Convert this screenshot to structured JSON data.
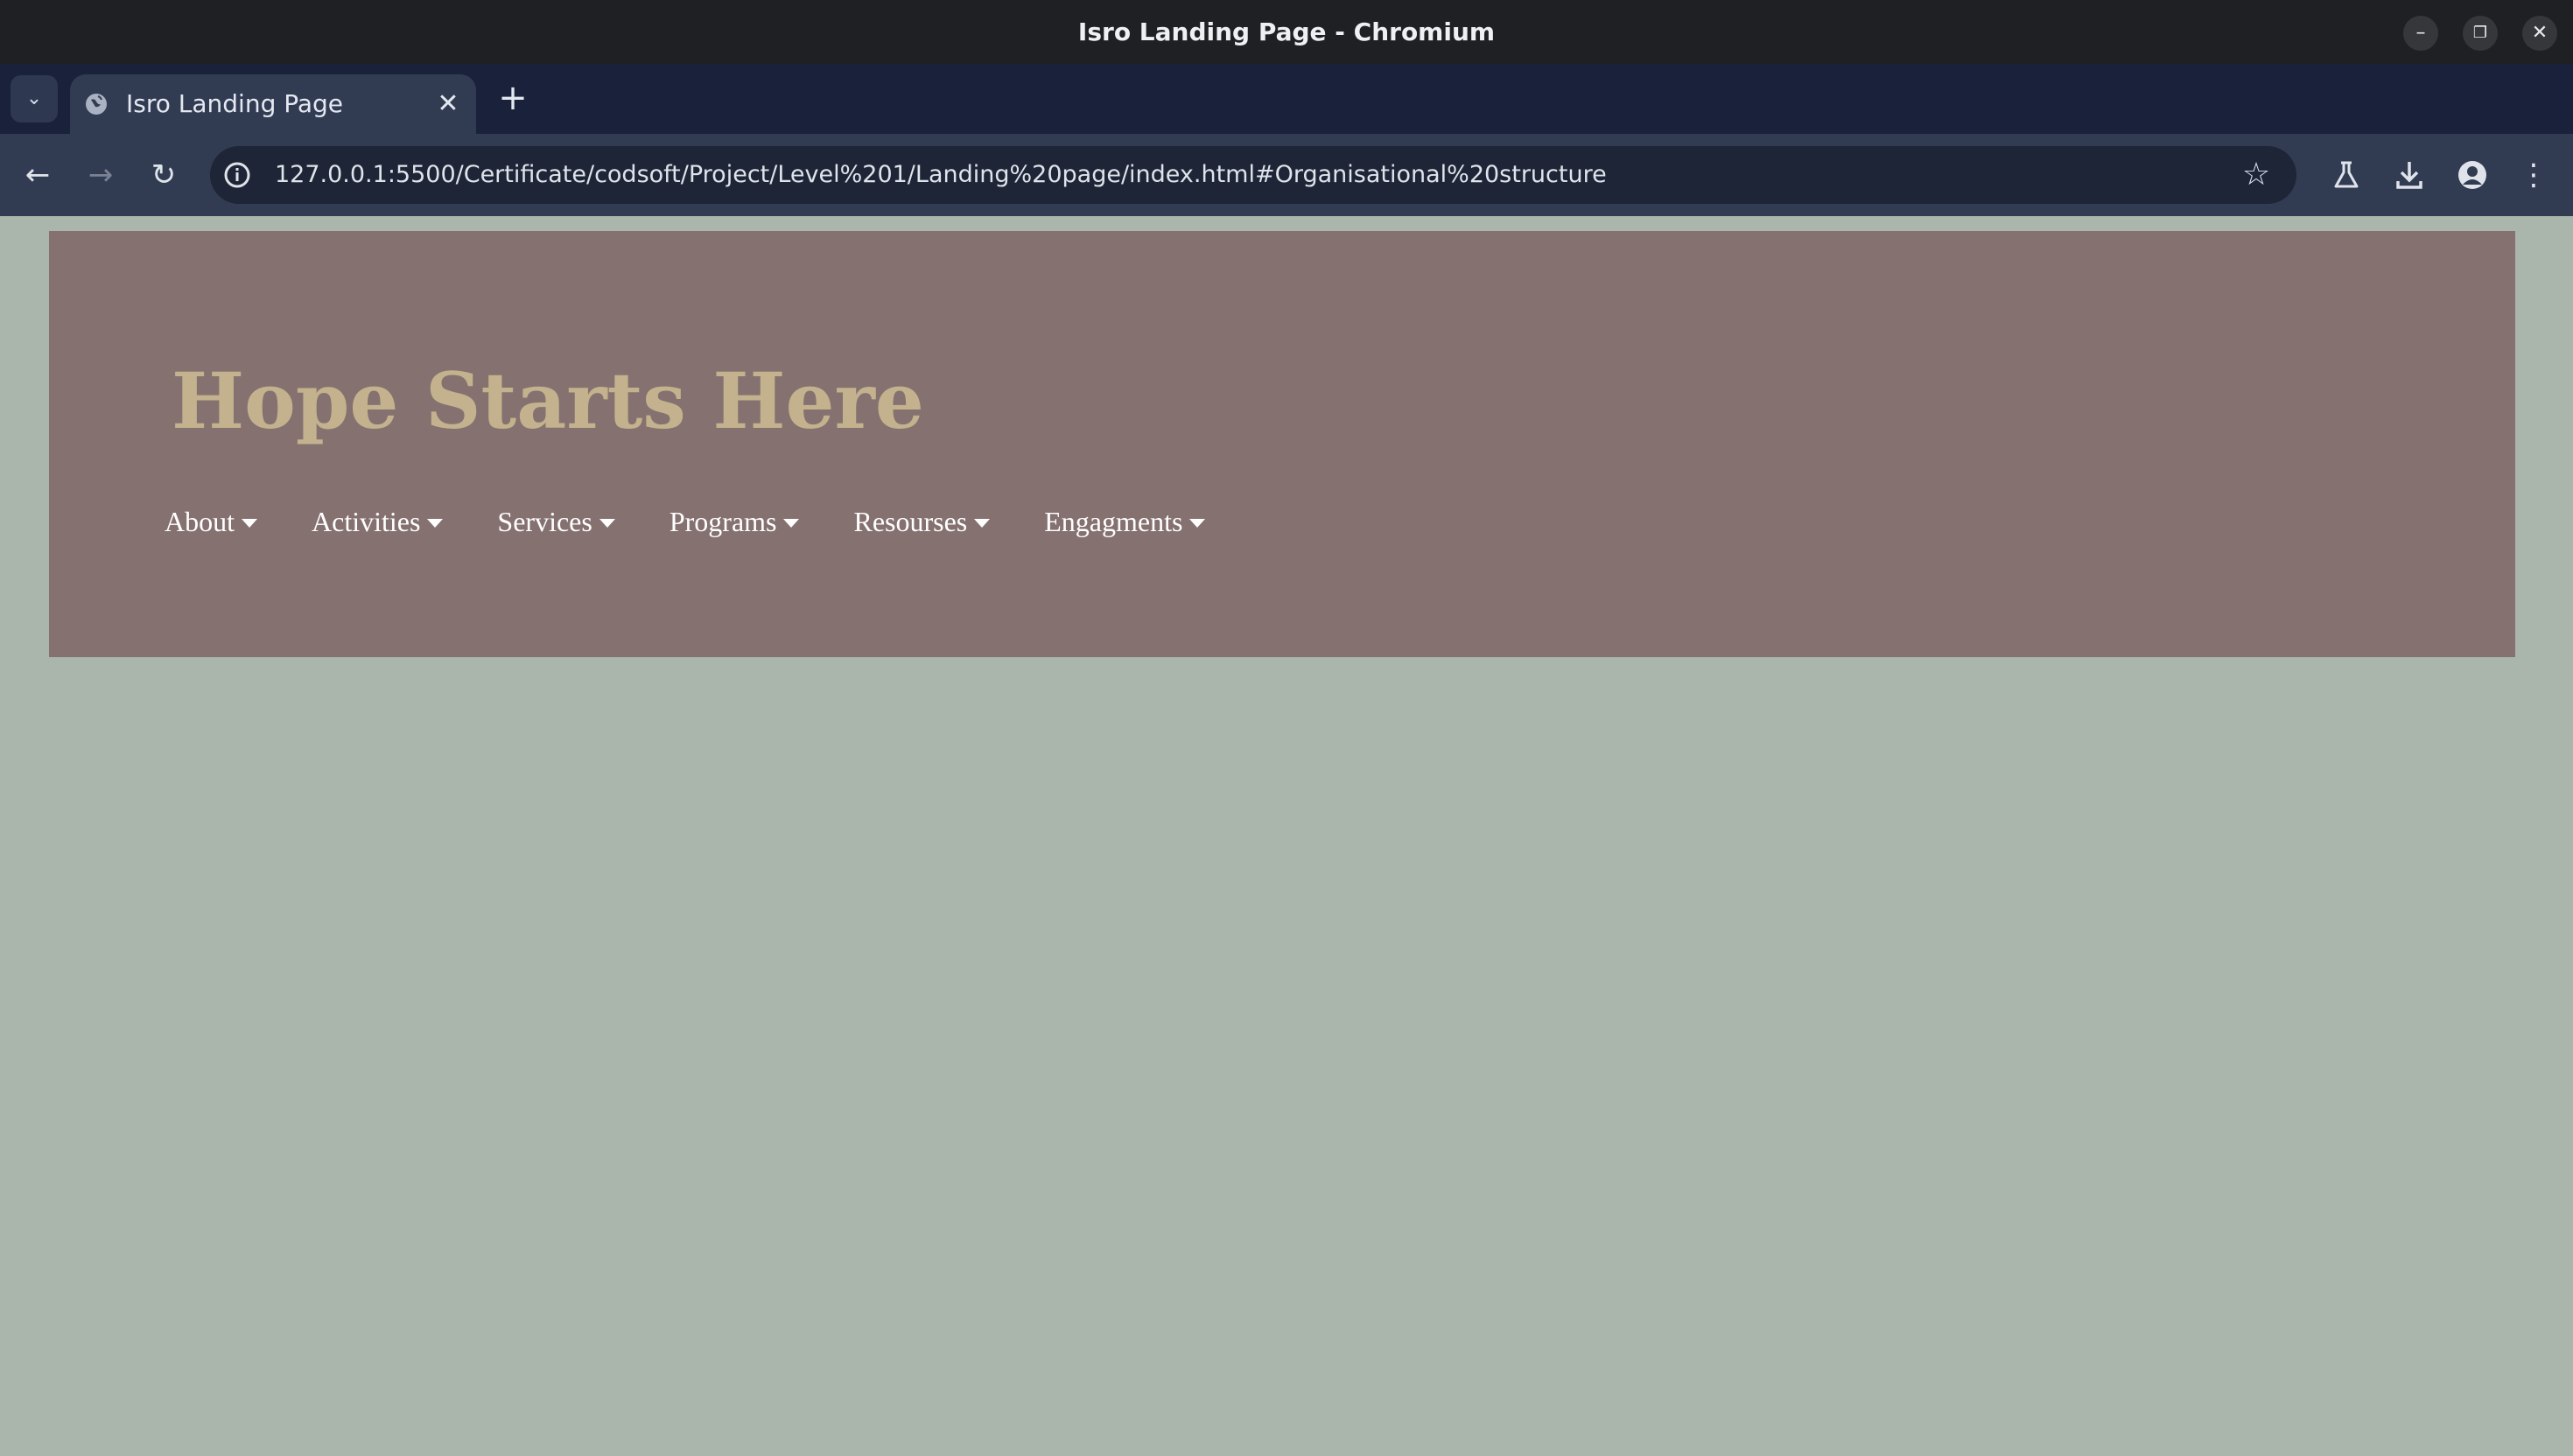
{
  "window": {
    "title": "Isro Landing Page - Chromium",
    "controls": {
      "minimize": "–",
      "restore": "❐",
      "close": "✕"
    }
  },
  "tabs": [
    {
      "title": "Isro Landing Page",
      "icon": "globe-icon",
      "active": true
    }
  ],
  "tabstrip": {
    "tab_list_symbol": "⌄",
    "new_tab_symbol": "+",
    "close_symbol": "✕"
  },
  "toolbar": {
    "back_symbol": "←",
    "forward_symbol": "→",
    "reload_symbol": "↻",
    "url": "127.0.0.1:5500/Certificate/codsoft/Project/Level%201/Landing%20page/index.html#Organisational%20structure",
    "bookmark_symbol": "☆",
    "menu_symbol": "⋮"
  },
  "page": {
    "heading": "Hope Starts Here",
    "nav": [
      {
        "label": "About"
      },
      {
        "label": "Activities"
      },
      {
        "label": "Services"
      },
      {
        "label": "Programs"
      },
      {
        "label": "Resourses"
      },
      {
        "label": "Engagments"
      }
    ]
  },
  "colors": {
    "page_background": "#aab5ab",
    "hero_background": "#857170",
    "heading_color": "#c3b28d",
    "nav_text": "#ffffff",
    "titlebar": "#1f2023",
    "tabstrip": "#19223a",
    "toolbar": "#313b52"
  }
}
